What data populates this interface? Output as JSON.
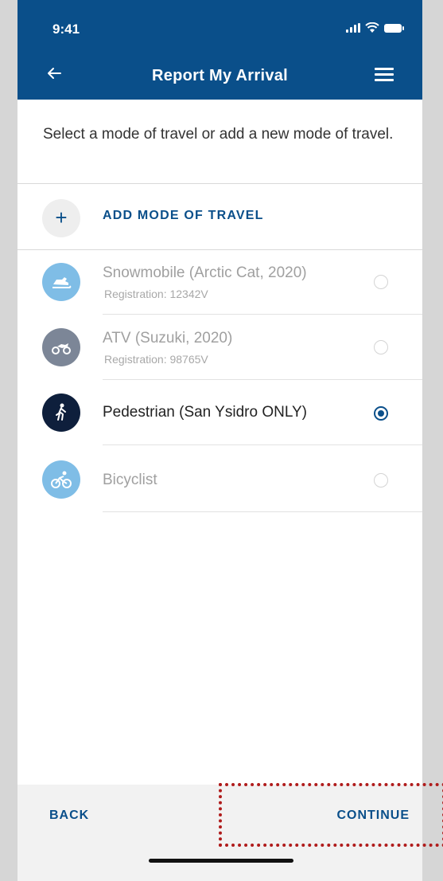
{
  "status_bar": {
    "time": "9:41"
  },
  "header": {
    "title": "Report My Arrival"
  },
  "instructions": "Select a mode of travel or add a new mode of travel.",
  "add_mode": {
    "label": "ADD MODE OF TRAVEL",
    "icon": "plus-icon"
  },
  "modes": [
    {
      "name": "Snowmobile (Arctic Cat, 2020)",
      "registration": "Registration: 12342V",
      "icon": "snowmobile-icon",
      "icon_color": "#7fbde6",
      "selected": false
    },
    {
      "name": "ATV (Suzuki, 2020)",
      "registration": "Registration: 98765V",
      "icon": "atv-icon",
      "icon_color": "#7c8697",
      "selected": false
    },
    {
      "name": "Pedestrian (San Ysidro ONLY)",
      "registration": "",
      "icon": "pedestrian-icon",
      "icon_color": "#0e1f3c",
      "selected": true
    },
    {
      "name": "Bicyclist",
      "registration": "",
      "icon": "bicycle-icon",
      "icon_color": "#7fbde6",
      "selected": false
    }
  ],
  "footer": {
    "back_label": "BACK",
    "continue_label": "CONTINUE"
  },
  "colors": {
    "brand": "#0a4f8a",
    "highlight": "#b01c1c"
  }
}
